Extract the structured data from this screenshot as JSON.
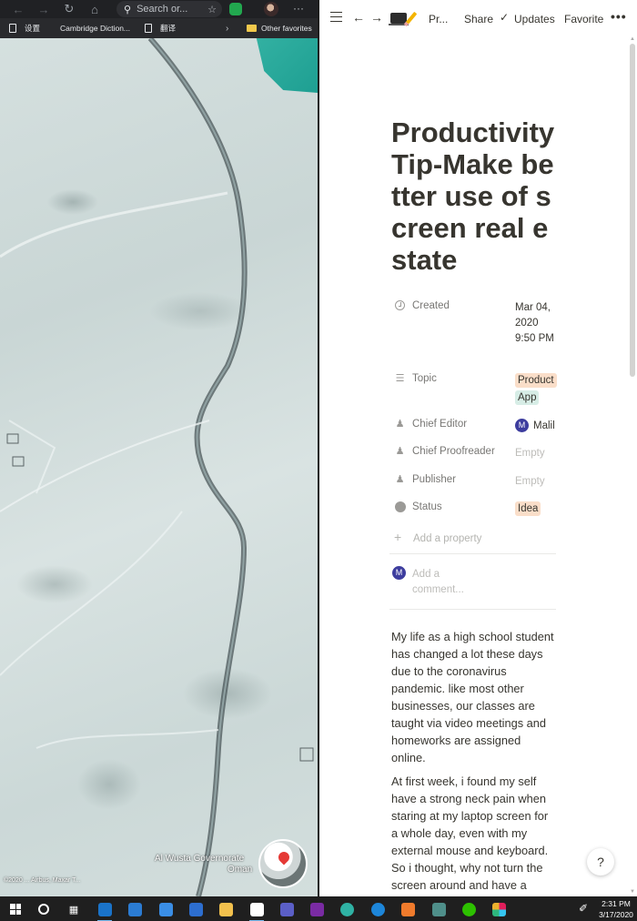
{
  "browser": {
    "address_placeholder": "Search or...",
    "bookmarks": [
      {
        "label": "设置"
      },
      {
        "label": "Cambridge Diction..."
      },
      {
        "label": "翻译"
      }
    ],
    "other_favorites": "Other favorites",
    "map": {
      "place_line1": "Al Wusta Governorate",
      "place_line2": "Oman",
      "credit": "©2020 ... Airbus, Maxar T..."
    }
  },
  "notion": {
    "topbar": {
      "breadcrumb": "Pr...",
      "share": "Share",
      "updates": "Updates",
      "favorite": "Favorite",
      "more": "•••"
    },
    "page_title": "Productivity Tip-Make better use of screen real estate",
    "properties": {
      "created": {
        "name": "Created",
        "value": "Mar 04, 2020 9:50 PM"
      },
      "topic": {
        "name": "Topic",
        "tags": [
          "Product",
          "App"
        ]
      },
      "chief_editor": {
        "name": "Chief Editor",
        "initial": "M",
        "value": "Malil"
      },
      "chief_proofreader": {
        "name": "Chief Proofreader",
        "value": "Empty"
      },
      "publisher": {
        "name": "Publisher",
        "value": "Empty"
      },
      "status": {
        "name": "Status",
        "value": "Idea"
      },
      "add_property": "Add a property"
    },
    "comment": {
      "initial": "M",
      "placeholder": "Add a comment..."
    },
    "body": [
      "My life as a high school student has changed a lot these days due to the coronavirus pandemic. like most other businesses, our classes are taught via video meetings and homeworks are assigned online.",
      "At first week, i found my self have a strong neck pain when staring at my laptop screen for a whole day, even with my external mouse and keyboard. So i thought, why not turn the screen around and have a"
    ],
    "help": "?",
    "colors": {
      "text": "#37352f",
      "tag_orange": "#fadec9",
      "tag_green": "#d7ede6",
      "avatar": "#3d3d9e"
    }
  },
  "taskbar": {
    "time": "2:31 PM",
    "date": "3/17/2020",
    "apps": [
      "search-icon",
      "task-view-icon",
      "mail-app-icon",
      "outlook-icon",
      "todo-icon",
      "calendar-icon",
      "file-explorer-icon",
      "notion-icon",
      "teams-icon",
      "onenote-icon",
      "edge-dev-icon",
      "edge-icon",
      "app-orange-icon",
      "app-teal-icon",
      "wechat-icon",
      "slack-icon"
    ]
  }
}
